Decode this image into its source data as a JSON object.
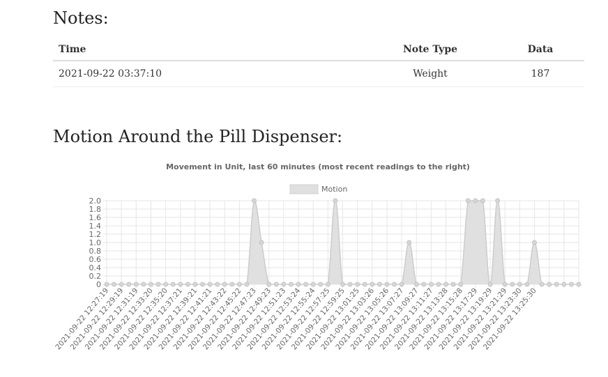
{
  "notes": {
    "heading": "Notes:",
    "columns": [
      "Time",
      "Note Type",
      "Data"
    ],
    "rows": [
      [
        "2021-09-22 03:37:10",
        "Weight",
        "187"
      ]
    ]
  },
  "motion": {
    "heading": "Motion Around the Pill Dispenser:"
  },
  "chart_data": {
    "type": "area",
    "title": "Movement in Unit, last 60 minutes (most recent readings to the right)",
    "xlabel": "",
    "ylabel": "",
    "legend": {
      "position": "top",
      "entries": [
        "Motion"
      ]
    },
    "ylim": [
      0,
      2.0
    ],
    "yticks": [
      "0",
      "0.2",
      "0.4",
      "0.6",
      "0.8",
      "1.0",
      "1.2",
      "1.4",
      "1.6",
      "1.8",
      "2.0"
    ],
    "grid": true,
    "x_tick_labels": [
      "2021-09-22 12:27:19",
      "2021-09-22 12:29:19",
      "2021-09-22 12:31:19",
      "2021-09-22 12:33:20",
      "2021-09-22 12:35:20",
      "2021-09-22 12:37:21",
      "2021-09-22 12:39:21",
      "2021-09-22 12:41:21",
      "2021-09-22 12:43:22",
      "2021-09-22 12:45:22",
      "2021-09-22 12:47:23",
      "2021-09-22 12:49:23",
      "2021-09-22 12:51:23",
      "2021-09-22 12:53:24",
      "2021-09-22 12:55:24",
      "2021-09-22 12:57:25",
      "2021-09-22 12:59:25",
      "2021-09-22 13:01:25",
      "2021-09-22 13:03:26",
      "2021-09-22 13:05:26",
      "2021-09-22 13:07:27",
      "2021-09-22 13:09:27",
      "2021-09-22 13:11:27",
      "2021-09-22 13:13:28",
      "2021-09-22 13:15:28",
      "2021-09-22 13:17:29",
      "2021-09-22 13:19:29",
      "2021-09-22 13:21:29",
      "2021-09-22 13:23:30",
      "2021-09-22 13:25:30"
    ],
    "series": [
      {
        "name": "Motion",
        "fill_color": "#e0e0e0",
        "line_color": "#cccccc",
        "values": [
          0,
          0,
          0,
          0,
          0,
          0,
          0,
          0,
          0,
          0,
          0,
          0,
          0,
          0,
          0,
          0,
          0,
          0,
          0,
          0,
          2,
          1,
          0,
          0,
          0,
          0,
          0,
          0,
          0,
          0,
          0,
          2,
          0,
          0,
          0,
          0,
          0,
          0,
          0,
          0,
          0,
          1,
          0,
          0,
          0,
          0,
          0,
          0,
          0,
          2,
          2,
          2,
          0,
          2,
          0,
          0,
          0,
          0,
          1,
          0,
          0,
          0,
          0,
          0,
          0
        ]
      }
    ]
  }
}
